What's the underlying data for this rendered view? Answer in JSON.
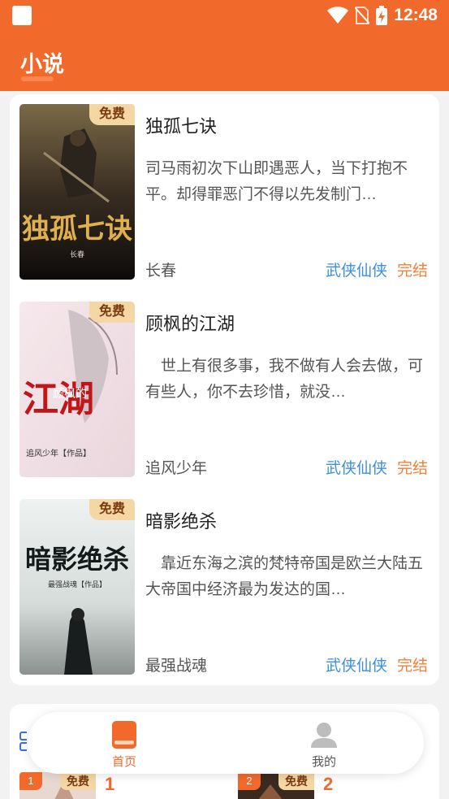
{
  "status_bar": {
    "time": "12:48"
  },
  "app": {
    "title": "小说"
  },
  "books": [
    {
      "title": "独孤七诀",
      "description": "司马雨初次下山即遇恶人，当下打抱不平。却得罪恶门不得以先发制门…",
      "author": "长春",
      "category": "武侠仙侠",
      "status": "完结",
      "tag": "免费",
      "cover_text": "独孤七诀",
      "cover_author": "长春"
    },
    {
      "title": "顾枫的江湖",
      "description": "　世上有很多事，我不做有人会去做，可有些人，你不去珍惜，就没…",
      "author": "追风少年",
      "category": "武侠仙侠",
      "status": "完结",
      "tag": "免费",
      "cover_text": "江湖",
      "cover_sub": "顾枫的",
      "cover_author": "追风少年【作品】"
    },
    {
      "title": "暗影绝杀",
      "description": "　靠近东海之滨的梵特帝国是欧兰大陆五大帝国中经济最为发达的国…",
      "author": "最强战魂",
      "category": "武侠仙侠",
      "status": "完结",
      "tag": "免费",
      "cover_text": "暗影绝杀",
      "cover_author": "最强战魂【作品】"
    }
  ],
  "ranking": {
    "items": [
      {
        "rank": "1",
        "tag": "免费",
        "number": "1"
      },
      {
        "rank": "2",
        "tag": "免费",
        "number": "2"
      }
    ]
  },
  "nav": {
    "items": [
      {
        "label": "首页",
        "icon": "book-icon",
        "active": true
      },
      {
        "label": "我的",
        "icon": "user-icon",
        "active": false
      }
    ]
  },
  "colors": {
    "primary": "#f26a2b",
    "category": "#3d8fe0",
    "status": "#f0803b",
    "tag_bg": "#f5d7a6"
  }
}
